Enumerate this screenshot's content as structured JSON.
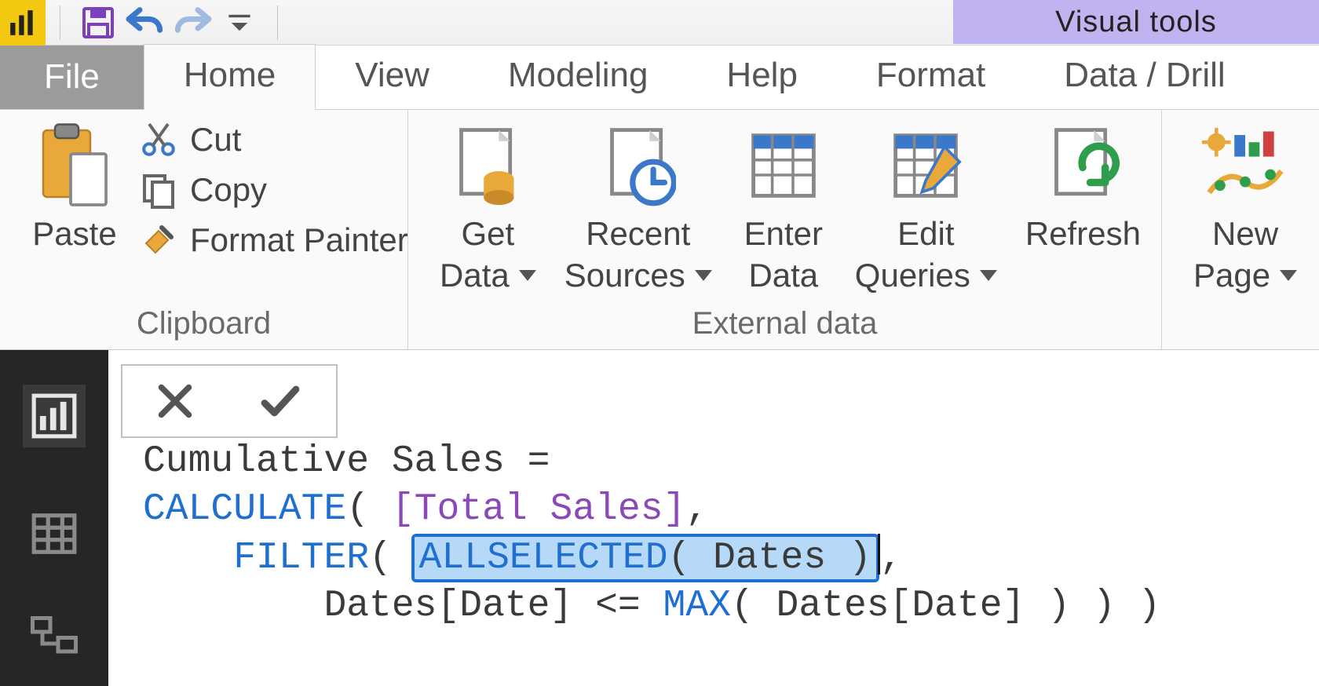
{
  "contextual_tab": "Visual tools",
  "tabs": {
    "file": "File",
    "home": "Home",
    "view": "View",
    "modeling": "Modeling",
    "help": "Help",
    "format": "Format",
    "data_drill": "Data / Drill"
  },
  "ribbon": {
    "clipboard": {
      "label": "Clipboard",
      "paste": "Paste",
      "cut": "Cut",
      "copy": "Copy",
      "format_painter": "Format Painter"
    },
    "external_data": {
      "label": "External data",
      "get_data": "Get",
      "get_data2": "Data",
      "recent_sources": "Recent",
      "recent_sources2": "Sources",
      "enter_data": "Enter",
      "enter_data2": "Data",
      "edit_queries": "Edit",
      "edit_queries2": "Queries",
      "refresh": "Refresh"
    },
    "insert": {
      "new_page": "New",
      "new_page2": "Page"
    }
  },
  "formula": {
    "line1_a": "Cumulative Sales = ",
    "line2_kw": "CALCULATE",
    "line2_paren": "( ",
    "line2_meas": "[Total Sales]",
    "line2_tail": ",",
    "line3_pad": "    ",
    "line3_kw": "FILTER",
    "line3_paren": "( ",
    "line3_hl_a": "ALLSELECTED",
    "line3_hl_b": "( Dates )",
    "line3_tail": ",",
    "line4_pad": "        ",
    "line4_a": "Dates[Date] <= ",
    "line4_kw": "MAX",
    "line4_b": "( Dates[Date] ) ) )"
  }
}
